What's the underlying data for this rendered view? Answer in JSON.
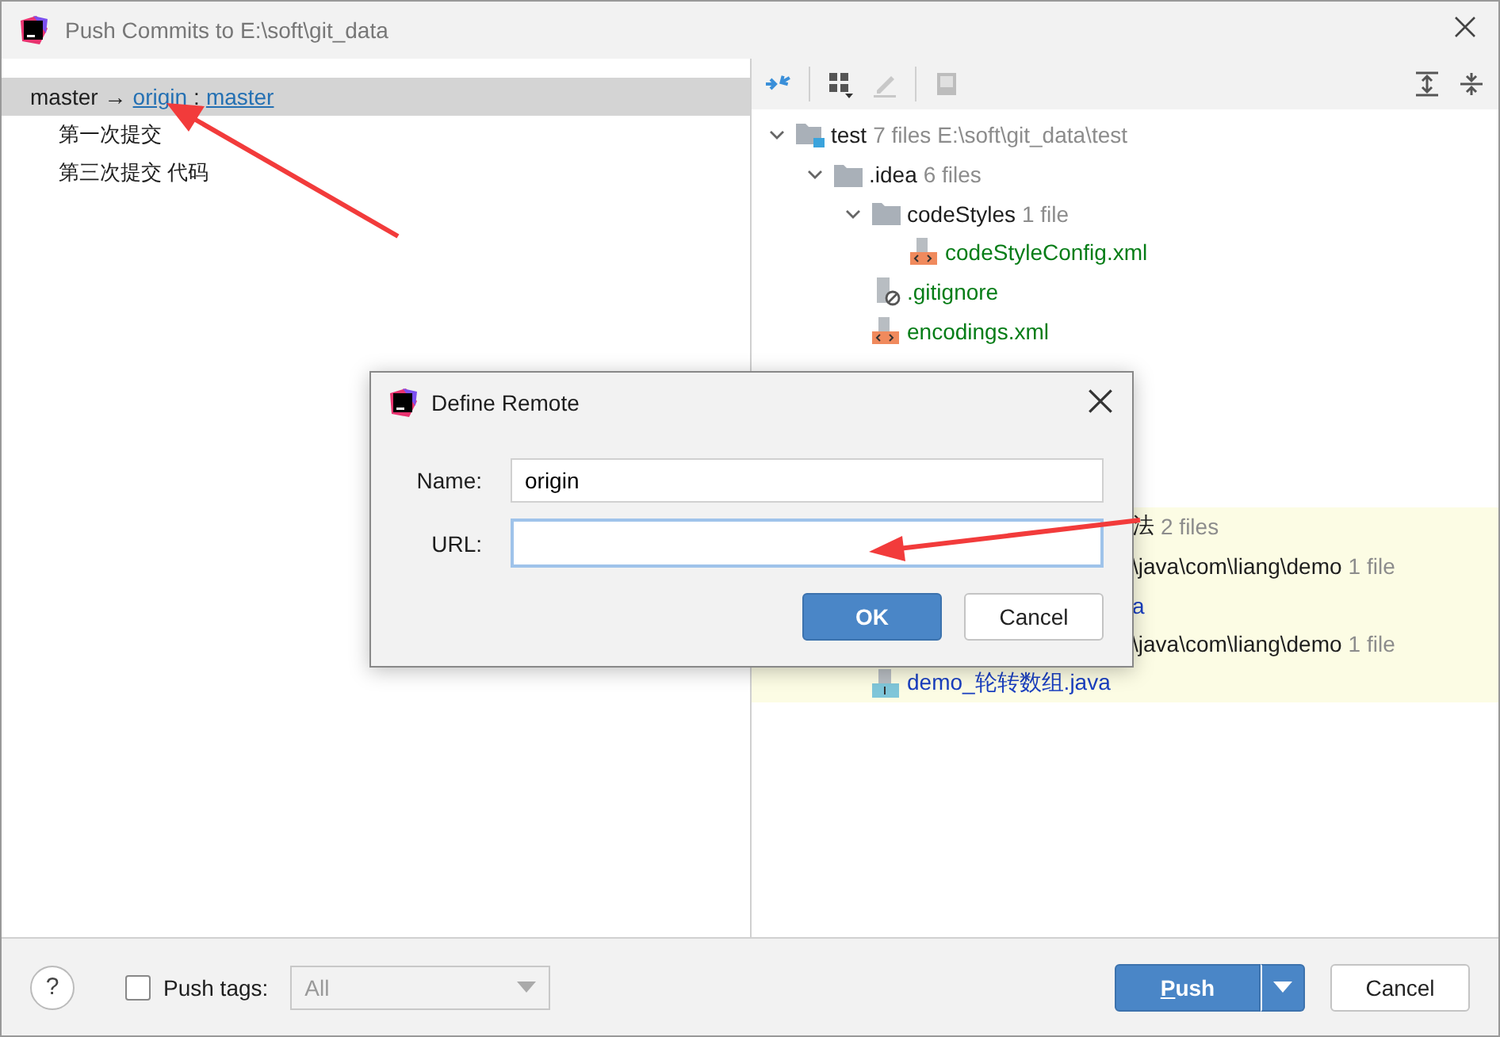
{
  "window": {
    "title": "Push Commits to E:\\soft\\git_data"
  },
  "push_tree": {
    "branch": {
      "local": "master",
      "arrow": "→",
      "remote": "origin",
      "separator": ":",
      "remote_branch": "master",
      "selected": true
    },
    "commits": [
      {
        "message": "第一次提交"
      },
      {
        "message": "第三次提交 代码"
      }
    ]
  },
  "file_tree": [
    {
      "kind": "module",
      "name": "test",
      "count": "7 files",
      "path": "E:\\soft\\git_data\\test",
      "expanded": true,
      "children": [
        {
          "kind": "folder",
          "name": ".idea",
          "count": "6 files",
          "expanded": true,
          "children": [
            {
              "kind": "folder",
              "name": "codeStyles",
              "count": "1 file",
              "expanded": true,
              "children": [
                {
                  "kind": "xml",
                  "name": "codeStyleConfig.xml",
                  "color": "#067d17"
                }
              ]
            },
            {
              "kind": "ignore",
              "name": ".gitignore",
              "color": "#067d17"
            },
            {
              "kind": "xml",
              "name": "encodings.xml",
              "color": "#067d17"
            },
            {
              "kind": "hidden"
            }
          ]
        },
        {
          "kind": "hidden"
        },
        {
          "kind": "hidden"
        },
        {
          "kind": "hidden"
        },
        {
          "kind": "fragment",
          "name": "法",
          "count": "2 files",
          "highlighted": true
        },
        {
          "kind": "fragment",
          "name": "\\java\\com\\liang\\demo",
          "count": "1 file",
          "highlighted": true
        },
        {
          "kind": "fragment",
          "name": "a",
          "color": "#1a3fbf",
          "highlighted": true
        },
        {
          "kind": "fragment",
          "name": "\\java\\com\\liang\\demo",
          "count": "1 file",
          "highlighted": true,
          "children": [
            {
              "kind": "java",
              "name": "demo_轮转数组.java",
              "color": "#1a3fbf",
              "highlighted": true
            }
          ]
        }
      ]
    }
  ],
  "dialog": {
    "title": "Define Remote",
    "fields": [
      {
        "label": "Name:",
        "value": "origin",
        "focused": false
      },
      {
        "label": "URL:",
        "focused": true
      }
    ],
    "buttons": [
      {
        "label": "OK",
        "primary": true
      },
      {
        "label": "Cancel",
        "primary": false
      }
    ]
  },
  "footer": {
    "help": "?",
    "push_tags": {
      "label": "Push tags:",
      "checked": false
    },
    "tags_select": {
      "value": "All",
      "disabled": true
    },
    "buttons": [
      {
        "label": "Push",
        "primary": true
      },
      {
        "label": "Cancel",
        "primary": false
      }
    ]
  }
}
